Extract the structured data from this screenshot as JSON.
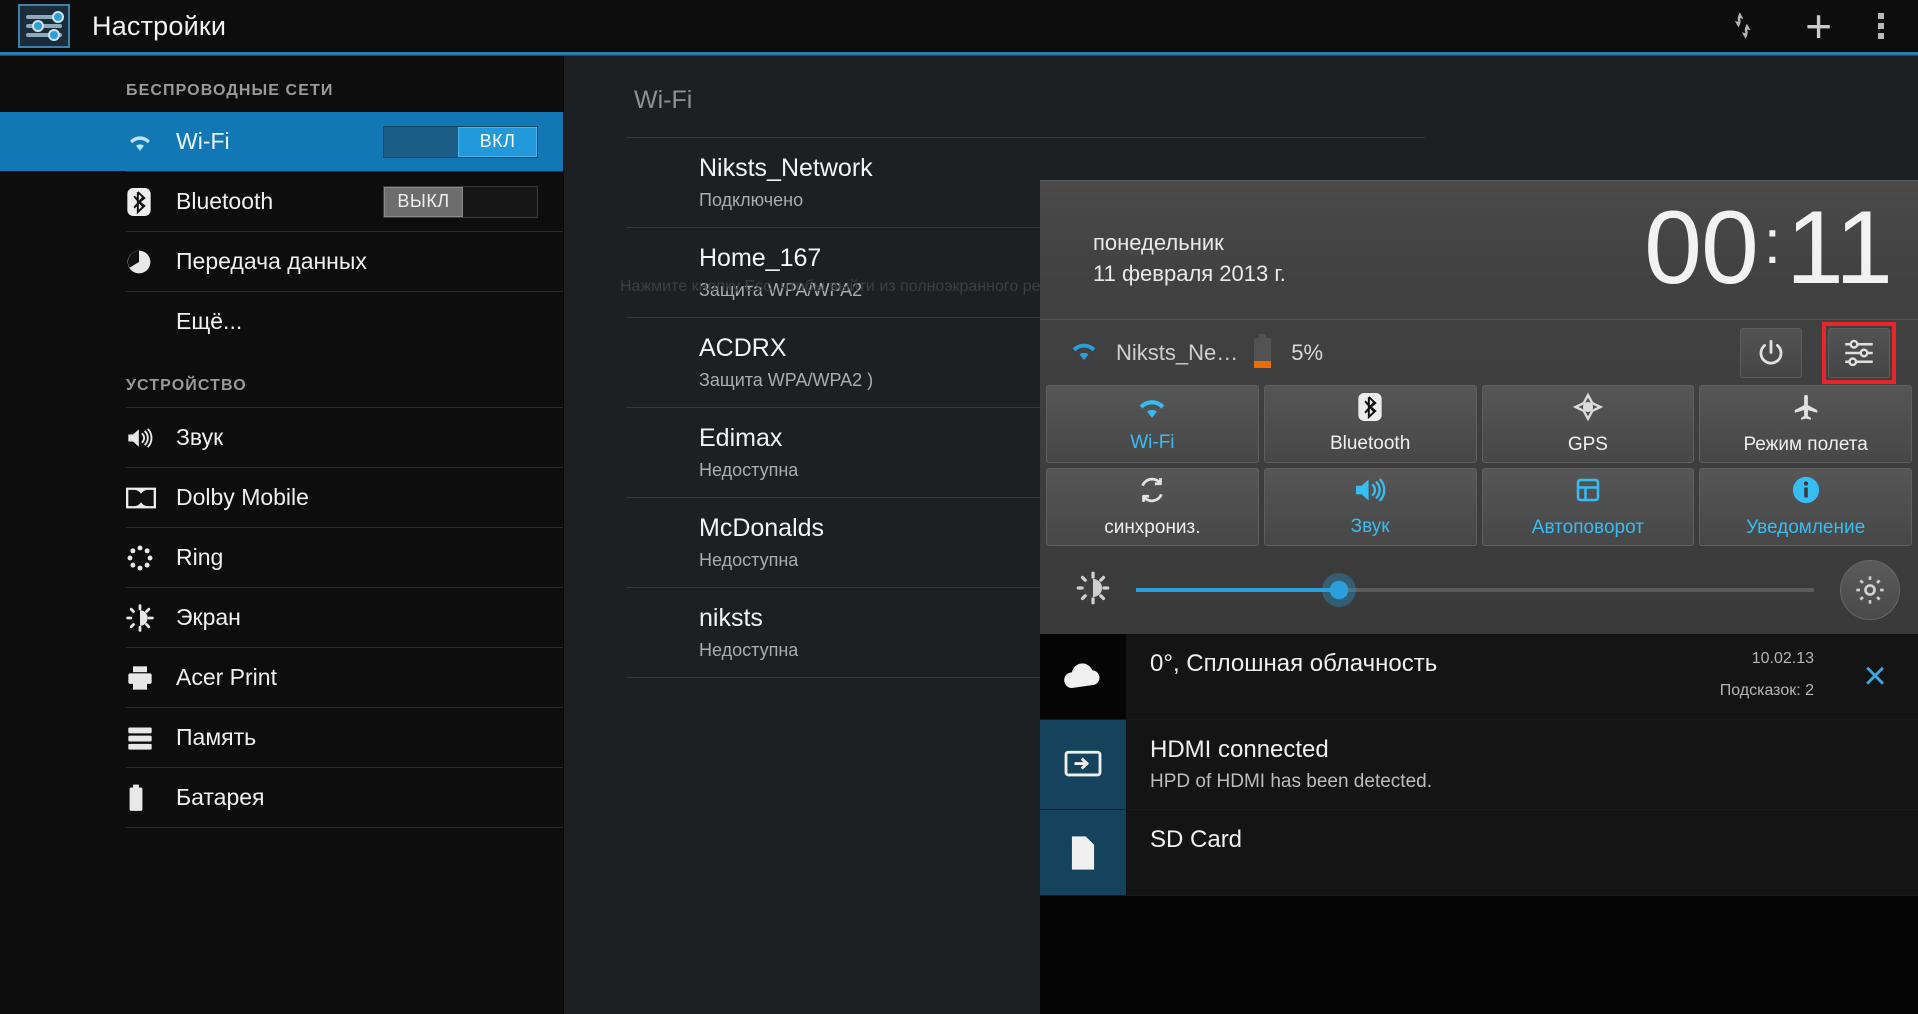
{
  "actionbar": {
    "title": "Настройки",
    "app_icon_name": "settings-sliders-icon",
    "icons": [
      {
        "name": "scan-refresh-icon",
        "glyph": "↺"
      },
      {
        "name": "add-icon",
        "glyph": "+"
      },
      {
        "name": "overflow-menu-icon",
        "glyph": "⋮"
      }
    ]
  },
  "sidebar": {
    "sections": [
      {
        "header": "БЕСПРОВОДНЫЕ СЕТИ",
        "items": [
          {
            "label": "Wi-Fi",
            "icon": "wifi-icon",
            "selected": true,
            "toggle": "on",
            "toggle_label": "ВКЛ"
          },
          {
            "label": "Bluetooth",
            "icon": "bluetooth-icon",
            "selected": false,
            "toggle": "off",
            "toggle_label": "ВЫКЛ"
          },
          {
            "label": "Передача данных",
            "icon": "data-usage-icon",
            "selected": false,
            "toggle": "none"
          },
          {
            "label": "Ещё...",
            "icon": "none",
            "selected": false,
            "toggle": "none"
          }
        ]
      },
      {
        "header": "УСТРОЙСТВО",
        "items": [
          {
            "label": "Звук",
            "icon": "speaker-icon",
            "selected": false,
            "toggle": "none"
          },
          {
            "label": "Dolby Mobile",
            "icon": "dolby-icon",
            "selected": false,
            "toggle": "none"
          },
          {
            "label": "Ring",
            "icon": "ring-dotted-circle-icon",
            "selected": false,
            "toggle": "none"
          },
          {
            "label": "Экран",
            "icon": "brightness-sun-icon",
            "selected": false,
            "toggle": "none"
          },
          {
            "label": "Acer Print",
            "icon": "printer-icon",
            "selected": false,
            "toggle": "none"
          },
          {
            "label": "Память",
            "icon": "storage-icon",
            "selected": false,
            "toggle": "none"
          },
          {
            "label": "Батарея",
            "icon": "battery-icon",
            "selected": false,
            "toggle": "none"
          }
        ]
      }
    ]
  },
  "content": {
    "heading": "Wi-Fi",
    "esc_hint": "Нажмите кнопку Esc, чтобы выйти из полноэкранного режима.",
    "networks": [
      {
        "name": "Niksts_Network",
        "status": "Подключено"
      },
      {
        "name": "Home_167",
        "status": "Защита WPA/WPA2"
      },
      {
        "name": "ACDRX",
        "status": "Защита WPA/WPA2 )"
      },
      {
        "name": "Edimax",
        "status": "Недоступна"
      },
      {
        "name": "McDonalds",
        "status": "Недоступна"
      },
      {
        "name": "niksts",
        "status": "Недоступна"
      }
    ]
  },
  "quick_settings": {
    "weekday": "понедельник",
    "date": "11 февраля 2013 г.",
    "clock_hours": "00",
    "clock_separator": ":",
    "clock_minutes": "11",
    "status": {
      "wifi_icon": "wifi-icon",
      "wifi_name": "Niksts_Ne…",
      "battery_icon": "battery-low-icon",
      "battery_percent": "5%"
    },
    "right_buttons": [
      {
        "name": "power-button",
        "glyph": "power-icon"
      },
      {
        "name": "quick-settings-button",
        "glyph": "sliders-icon",
        "highlighted": true,
        "highlight_color": "#e8252a"
      }
    ],
    "tiles": [
      {
        "label": "Wi-Fi",
        "icon": "wifi-icon",
        "active": true
      },
      {
        "label": "Bluetooth",
        "icon": "bluetooth-icon",
        "active": false
      },
      {
        "label": "GPS",
        "icon": "gps-crosshair-icon",
        "active": false
      },
      {
        "label": "Режим полета",
        "icon": "airplane-icon",
        "active": false
      },
      {
        "label": "синхрониз.",
        "icon": "sync-icon",
        "active": false
      },
      {
        "label": "Звук",
        "icon": "speaker-icon",
        "active": true
      },
      {
        "label": "Автоповорот",
        "icon": "rotate-screen-icon",
        "active": true
      },
      {
        "label": "Уведомление",
        "icon": "info-icon",
        "active": true
      }
    ],
    "brightness": {
      "icon": "brightness-sun-icon",
      "value_percent": 29,
      "settings_icon": "gear-icon"
    }
  },
  "notifications": [
    {
      "icon": "cloud-icon",
      "title": "0°, Сплошная облачность",
      "subtitle": "",
      "time": "10.02.13",
      "count": "Подсказок: 2",
      "close_glyph": "×",
      "tinted": false
    },
    {
      "icon": "hdmi-display-icon",
      "title": "HDMI connected",
      "subtitle": "HPD of HDMI has been detected.",
      "time": "",
      "count": "",
      "close_glyph": "",
      "tinted": true
    },
    {
      "icon": "sdcard-icon",
      "title": "SD Card",
      "subtitle": "",
      "time": "",
      "count": "",
      "close_glyph": "",
      "tinted": true
    }
  ],
  "colors": {
    "accent": "#2a9fdc",
    "selected_row": "#1278b5",
    "highlight": "#e8252a",
    "battery_low": "#ef6c00"
  }
}
